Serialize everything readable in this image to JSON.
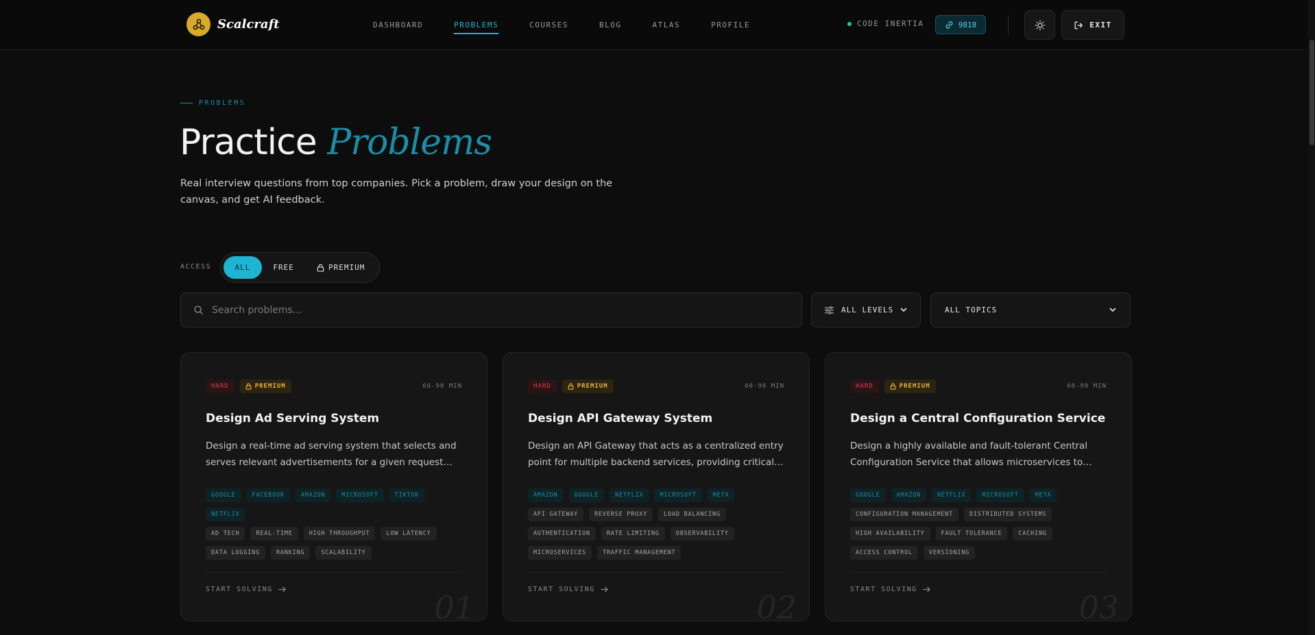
{
  "brand": {
    "name": "Scalcraft"
  },
  "nav": {
    "links": [
      "DASHBOARD",
      "PROBLEMS",
      "COURSES",
      "BLOG",
      "ATLAS",
      "PROFILE"
    ],
    "active": "PROBLEMS",
    "status_text": "CODE INERTIA",
    "credits": "9818",
    "exit_label": "EXIT"
  },
  "hero": {
    "eyebrow": "PROBLEMS",
    "title_main": "Practice ",
    "title_accent": "Problems",
    "subtitle": "Real interview questions from top companies. Pick a problem, draw your design on the canvas, and get AI feedback."
  },
  "access": {
    "label": "ACCESS",
    "options": {
      "all": "ALL",
      "free": "FREE",
      "premium": "PREMIUM"
    },
    "selected": "ALL"
  },
  "search": {
    "placeholder": "Search problems..."
  },
  "filters": {
    "levels": "ALL LEVELS",
    "topics": "ALL TOPICS"
  },
  "cards": [
    {
      "difficulty": "HARD",
      "access": "PREMIUM",
      "duration": "60-90 MIN",
      "title": "Design Ad Serving System",
      "description": "Design a real-time ad serving system that selects and serves relevant advertisements for a given request context, with low latency and high throughput.",
      "companies": [
        "GOOGLE",
        "FACEBOOK",
        "AMAZON",
        "MICROSOFT",
        "TIKTOK",
        "NETFLIX"
      ],
      "topics": [
        "AD TECH",
        "REAL-TIME",
        "HIGH THROUGHPUT",
        "LOW LATENCY",
        "DATA LOGGING",
        "RANKING",
        "SCALABILITY"
      ],
      "cta": "START SOLVING",
      "number": "01"
    },
    {
      "difficulty": "HARD",
      "access": "PREMIUM",
      "duration": "60-90 MIN",
      "title": "Design API Gateway System",
      "description": "Design an API Gateway that acts as a centralized entry point for multiple backend services, providing critical functionalities such as routing and rate limiting.",
      "companies": [
        "AMAZON",
        "GOOGLE",
        "NETFLIX",
        "MICROSOFT",
        "META"
      ],
      "topics": [
        "API GATEWAY",
        "REVERSE PROXY",
        "LOAD BALANCING",
        "AUTHENTICATION",
        "RATE LIMITING",
        "OBSERVABILITY",
        "MICROSERVICES",
        "TRAFFIC MANAGEMENT"
      ],
      "cta": "START SOLVING",
      "number": "02"
    },
    {
      "difficulty": "HARD",
      "access": "PREMIUM",
      "duration": "60-90 MIN",
      "title": "Design a Central Configuration Service",
      "description": "Design a highly available and fault-tolerant Central Configuration Service that allows microservices to fetch their configuration dynamically.",
      "companies": [
        "GOOGLE",
        "AMAZON",
        "NETFLIX",
        "MICROSOFT",
        "META"
      ],
      "topics": [
        "CONFIGURATION MANAGEMENT",
        "DISTRIBUTED SYSTEMS",
        "HIGH AVAILABILITY",
        "FAULT TOLERANCE",
        "CACHING",
        "ACCESS CONTROL",
        "VERSIONING"
      ],
      "cta": "START SOLVING",
      "number": "03"
    }
  ]
}
